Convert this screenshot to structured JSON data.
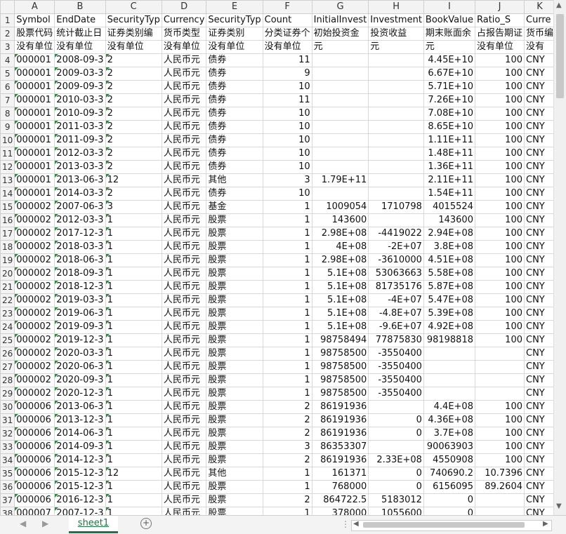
{
  "sheet": {
    "columns": [
      "A",
      "B",
      "C",
      "D",
      "E",
      "F",
      "G",
      "H",
      "I",
      "J",
      "K"
    ],
    "header_rows": [
      [
        "Symbol",
        "EndDate",
        "SecurityTyp",
        "Currency",
        "SecurityTyp",
        "Count",
        "InitialInvest",
        "Investment",
        "BookValue",
        "Ratio_S",
        "Curre"
      ],
      [
        "股票代码",
        "统计截止日",
        "证券类别编",
        "货币类型",
        "证券类别",
        "分类证券个",
        "初始投资金",
        "投资收益",
        "期末账面余",
        "占报告期证",
        "货币编"
      ],
      [
        "没有单位",
        "没有单位",
        "没有单位",
        "没有单位",
        "没有单位",
        "没有单位",
        "元",
        "元",
        "元",
        "没有单位",
        "没有"
      ]
    ],
    "rows": [
      [
        "000001",
        "2008-09-3",
        "2",
        "人民币元",
        "债券",
        "11",
        "",
        "",
        "4.45E+10",
        "100",
        "CNY"
      ],
      [
        "000001",
        "2009-03-3",
        "2",
        "人民币元",
        "债券",
        "9",
        "",
        "",
        "6.67E+10",
        "100",
        "CNY"
      ],
      [
        "000001",
        "2009-09-3",
        "2",
        "人民币元",
        "债券",
        "10",
        "",
        "",
        "5.71E+10",
        "100",
        "CNY"
      ],
      [
        "000001",
        "2010-03-3",
        "2",
        "人民币元",
        "债券",
        "11",
        "",
        "",
        "7.26E+10",
        "100",
        "CNY"
      ],
      [
        "000001",
        "2010-09-3",
        "2",
        "人民币元",
        "债券",
        "10",
        "",
        "",
        "7.08E+10",
        "100",
        "CNY"
      ],
      [
        "000001",
        "2011-03-3",
        "2",
        "人民币元",
        "债券",
        "10",
        "",
        "",
        "8.65E+10",
        "100",
        "CNY"
      ],
      [
        "000001",
        "2011-09-3",
        "2",
        "人民币元",
        "债券",
        "10",
        "",
        "",
        "1.11E+11",
        "100",
        "CNY"
      ],
      [
        "000001",
        "2012-03-3",
        "2",
        "人民币元",
        "债券",
        "10",
        "",
        "",
        "1.48E+11",
        "100",
        "CNY"
      ],
      [
        "000001",
        "2013-03-3",
        "2",
        "人民币元",
        "债券",
        "10",
        "",
        "",
        "1.36E+11",
        "100",
        "CNY"
      ],
      [
        "000001",
        "2013-06-3",
        "12",
        "人民币元",
        "其他",
        "3",
        "1.79E+11",
        "",
        "2.11E+11",
        "100",
        "CNY"
      ],
      [
        "000001",
        "2014-03-3",
        "2",
        "人民币元",
        "债券",
        "10",
        "",
        "",
        "1.54E+11",
        "100",
        "CNY"
      ],
      [
        "000002",
        "2007-06-3",
        "3",
        "人民币元",
        "基金",
        "1",
        "1009054",
        "1710798",
        "4015524",
        "100",
        "CNY"
      ],
      [
        "000002",
        "2012-03-3",
        "1",
        "人民币元",
        "股票",
        "1",
        "143600",
        "",
        "143600",
        "100",
        "CNY"
      ],
      [
        "000002",
        "2017-12-3",
        "1",
        "人民币元",
        "股票",
        "1",
        "2.98E+08",
        "-4419022",
        "2.94E+08",
        "100",
        "CNY"
      ],
      [
        "000002",
        "2018-03-3",
        "1",
        "人民币元",
        "股票",
        "1",
        "4E+08",
        "-2E+07",
        "3.8E+08",
        "100",
        "CNY"
      ],
      [
        "000002",
        "2018-06-3",
        "1",
        "人民币元",
        "股票",
        "1",
        "2.98E+08",
        "-3610000",
        "4.51E+08",
        "100",
        "CNY"
      ],
      [
        "000002",
        "2018-09-3",
        "1",
        "人民币元",
        "股票",
        "1",
        "5.1E+08",
        "53063663",
        "5.58E+08",
        "100",
        "CNY"
      ],
      [
        "000002",
        "2018-12-3",
        "1",
        "人民币元",
        "股票",
        "1",
        "5.1E+08",
        "81735176",
        "5.87E+08",
        "100",
        "CNY"
      ],
      [
        "000002",
        "2019-03-3",
        "1",
        "人民币元",
        "股票",
        "1",
        "5.1E+08",
        "-4E+07",
        "5.47E+08",
        "100",
        "CNY"
      ],
      [
        "000002",
        "2019-06-3",
        "1",
        "人民币元",
        "股票",
        "1",
        "5.1E+08",
        "-4.8E+07",
        "5.39E+08",
        "100",
        "CNY"
      ],
      [
        "000002",
        "2019-09-3",
        "1",
        "人民币元",
        "股票",
        "1",
        "5.1E+08",
        "-9.6E+07",
        "4.92E+08",
        "100",
        "CNY"
      ],
      [
        "000002",
        "2019-12-3",
        "1",
        "人民币元",
        "股票",
        "1",
        "98758494",
        "77875830",
        "98198818",
        "100",
        "CNY"
      ],
      [
        "000002",
        "2020-03-3",
        "1",
        "人民币元",
        "股票",
        "1",
        "98758500",
        "-3550400",
        "",
        "",
        "CNY"
      ],
      [
        "000002",
        "2020-06-3",
        "1",
        "人民币元",
        "股票",
        "1",
        "98758500",
        "-3550400",
        "",
        "",
        "CNY"
      ],
      [
        "000002",
        "2020-09-3",
        "1",
        "人民币元",
        "股票",
        "1",
        "98758500",
        "-3550400",
        "",
        "",
        "CNY"
      ],
      [
        "000002",
        "2020-12-3",
        "1",
        "人民币元",
        "股票",
        "1",
        "98758500",
        "-3550400",
        "",
        "",
        "CNY"
      ],
      [
        "000006",
        "2013-06-3",
        "1",
        "人民币元",
        "股票",
        "2",
        "86191936",
        "",
        "4.4E+08",
        "100",
        "CNY"
      ],
      [
        "000006",
        "2013-12-3",
        "1",
        "人民币元",
        "股票",
        "2",
        "86191936",
        "0",
        "4.36E+08",
        "100",
        "CNY"
      ],
      [
        "000006",
        "2014-06-3",
        "1",
        "人民币元",
        "股票",
        "2",
        "86191936",
        "0",
        "3.7E+08",
        "100",
        "CNY"
      ],
      [
        "000006",
        "2014-09-3",
        "1",
        "人民币元",
        "股票",
        "3",
        "86353307",
        "",
        "90063903",
        "100",
        "CNY"
      ],
      [
        "000006",
        "2014-12-3",
        "1",
        "人民币元",
        "股票",
        "2",
        "86191936",
        "2.33E+08",
        "4550908",
        "100",
        "CNY"
      ],
      [
        "000006",
        "2015-12-3",
        "12",
        "人民币元",
        "其他",
        "1",
        "161371",
        "0",
        "740690.2",
        "10.7396",
        "CNY"
      ],
      [
        "000006",
        "2015-12-3",
        "1",
        "人民币元",
        "股票",
        "1",
        "768000",
        "0",
        "6156095",
        "89.2604",
        "CNY"
      ],
      [
        "000006",
        "2016-12-3",
        "1",
        "人民币元",
        "股票",
        "2",
        "864722.5",
        "5183012",
        "0",
        "",
        "CNY"
      ],
      [
        "000007",
        "2007-12-3",
        "1",
        "人民币元",
        "股票",
        "1",
        "378000",
        "1055600",
        "0",
        "",
        "CNY"
      ]
    ]
  },
  "tabs": {
    "active": "sheet1"
  },
  "controls": {
    "nav_prev_icon": "◀",
    "nav_next_icon": "▶",
    "add_sheet_icon": "+",
    "more_icon": "⋮",
    "scroll_up_icon": "▲",
    "scroll_down_icon": "▼",
    "scroll_left_icon": "◀",
    "scroll_right_icon": "▶"
  }
}
